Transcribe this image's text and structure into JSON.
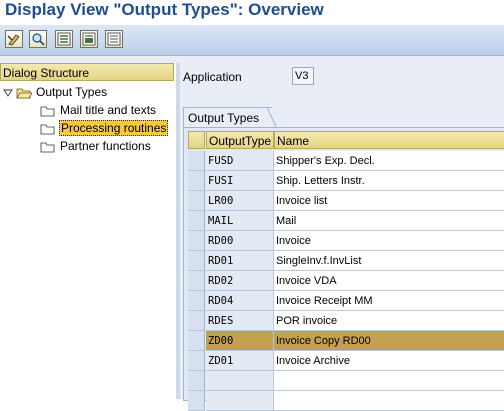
{
  "title": "Display View \"Output Types\": Overview",
  "toolbar": {
    "buttons": [
      "display-change-icon",
      "details-icon",
      "select-all-icon",
      "select-block-icon",
      "deselect-all-icon"
    ]
  },
  "dialog_structure": {
    "header": "Dialog Structure",
    "items": [
      {
        "label": "Output Types",
        "level": 0,
        "expanded": true,
        "selected": false
      },
      {
        "label": "Mail title and texts",
        "level": 1,
        "selected": false
      },
      {
        "label": "Processing routines",
        "level": 1,
        "selected": true
      },
      {
        "label": "Partner functions",
        "level": 1,
        "selected": false
      }
    ]
  },
  "application": {
    "label": "Application",
    "value": "V3"
  },
  "tab": {
    "label": "Output Types"
  },
  "table": {
    "columns": [
      "OutputType",
      "Name"
    ],
    "rows": [
      {
        "code": "FUSD",
        "name": "Shipper's Exp. Decl."
      },
      {
        "code": "FUSI",
        "name": "Ship. Letters Instr."
      },
      {
        "code": "LR00",
        "name": "Invoice list"
      },
      {
        "code": "MAIL",
        "name": "Mail"
      },
      {
        "code": "RD00",
        "name": "Invoice"
      },
      {
        "code": "RD01",
        "name": "SingleInv.f.InvList"
      },
      {
        "code": "RD02",
        "name": "Invoice VDA"
      },
      {
        "code": "RD04",
        "name": "Invoice Receipt MM"
      },
      {
        "code": "RDES",
        "name": "POR invoice"
      },
      {
        "code": "ZD00",
        "name": "Invoice Copy RD00"
      },
      {
        "code": "ZD01",
        "name": "Invoice Archive"
      },
      {
        "code": "",
        "name": ""
      },
      {
        "code": "",
        "name": ""
      }
    ],
    "highlighted_row": 9
  },
  "colors": {
    "title": "#1f4e8f",
    "header_yellow": "#e4d482",
    "selected_row": "#c4a151"
  }
}
